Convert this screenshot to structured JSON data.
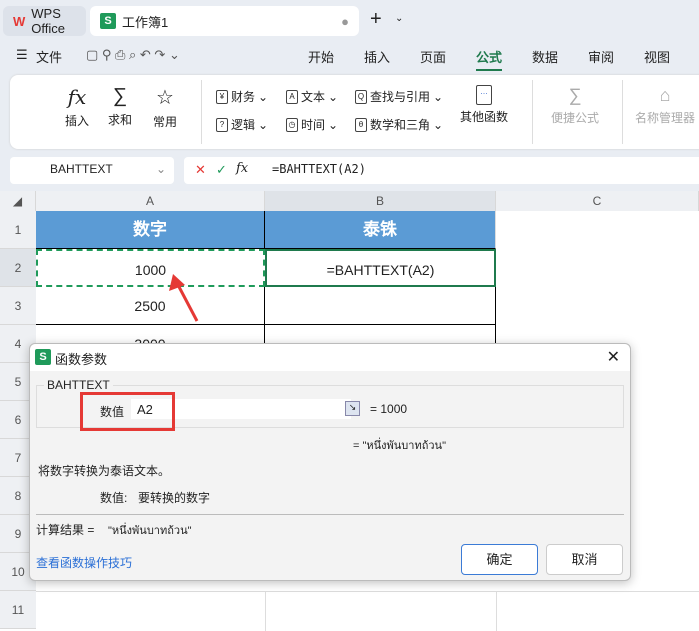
{
  "tabs": {
    "home": "WPS Office",
    "doc": "工作簿1"
  },
  "menu": {
    "file": "文件",
    "items": [
      "开始",
      "插入",
      "页面",
      "公式",
      "数据",
      "审阅",
      "视图"
    ],
    "active": "公式"
  },
  "ribbon": {
    "insert": "插入",
    "sum": "求和",
    "common": "常用",
    "finance": "财务",
    "text": "文本",
    "lookup": "查找与引用",
    "logic": "逻辑",
    "time": "时间",
    "math": "数学和三角",
    "other": "其他函数",
    "quick": "便捷公式",
    "names": "名称管理器"
  },
  "formula_bar": {
    "name_box": "BAHTTEXT",
    "formula": "=BAHTTEXT(A2)",
    "fx": "fx"
  },
  "columns": [
    "A",
    "B",
    "C"
  ],
  "rows": [
    "1",
    "2",
    "3",
    "4",
    "5",
    "6",
    "7",
    "8",
    "9",
    "10",
    "11"
  ],
  "cells": {
    "a1": "数字",
    "b1": "泰铢",
    "a2": "1000",
    "b2": "=BAHTTEXT(A2)",
    "a3": "2500",
    "a4": "3000"
  },
  "dialog": {
    "title": "函数参数",
    "group": "BAHTTEXT",
    "arg_label": "数值",
    "arg_value": "A2",
    "arg_result": "= 1000",
    "func_result": "= \"หนึ่งพันบาทถ้วน\"",
    "description": "将数字转换为泰语文本。",
    "arg_desc_label": "数值:",
    "arg_desc": "要转换的数字",
    "calc_label": "计算结果 =",
    "calc_value": "\"หนึ่งพันบาทถ้วน\"",
    "help_link": "查看函数操作技巧",
    "ok": "确定",
    "cancel": "取消"
  },
  "colors": {
    "header_fill": "#5b9bd5",
    "accent": "#1f7a4d",
    "highlight": "#e53935"
  }
}
